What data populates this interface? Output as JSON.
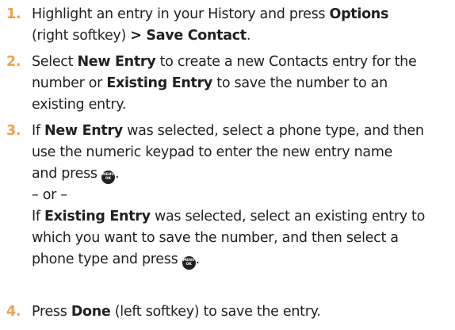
{
  "colors": {
    "step_number": "#f0a04b",
    "text": "#231f20"
  },
  "icons": {
    "menu_ok": "menu-ok-key-icon"
  },
  "menu_ok_key": {
    "top": "MENU",
    "bottom": "OK"
  },
  "steps": [
    {
      "number": "1.",
      "l1_a": "Highlight an entry in your History and press ",
      "l1_b": "Options",
      "l2_a": "(right softkey) ",
      "l2_b": "> Save Contact",
      "l2_c": "."
    },
    {
      "number": "2.",
      "l1_a": "Select ",
      "l1_b": "New Entry",
      "l1_c": " to create a new Contacts entry for the",
      "l2_a": "number or ",
      "l2_b": "Existing Entry",
      "l2_c": " to save the number to an",
      "l3": "existing entry."
    },
    {
      "number": "3.",
      "l1_a": "If ",
      "l1_b": "New Entry",
      "l1_c": " was selected, select a phone type, and then",
      "l2": "use the numeric keypad to enter the new entry name",
      "l3_a": "and press ",
      "l3_b": ".",
      "or": "– or –",
      "l5_a": "If ",
      "l5_b": "Existing Entry",
      "l5_c": " was selected, select an existing entry to",
      "l6": "which you want to save the number, and then select a",
      "l7_a": "phone type and press ",
      "l7_b": "."
    },
    {
      "number": "4.",
      "l1_a": "Press ",
      "l1_b": "Done",
      "l1_c": " (left softkey) to save the entry."
    }
  ]
}
